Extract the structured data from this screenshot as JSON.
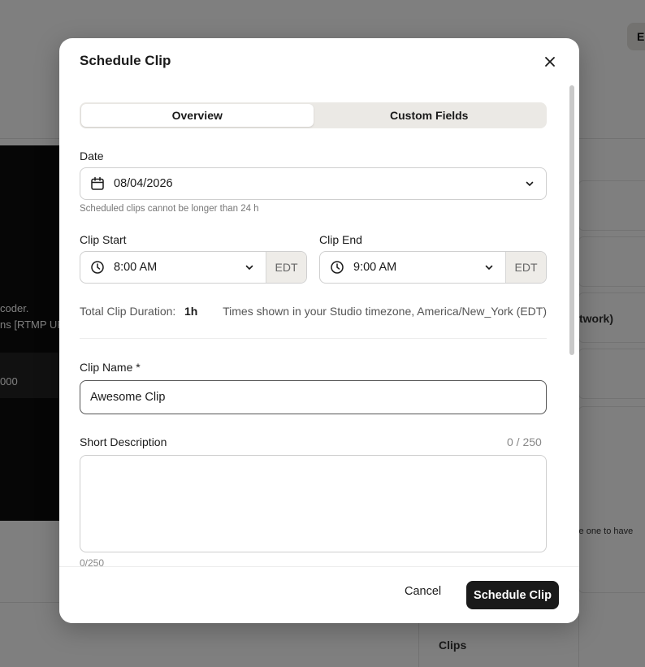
{
  "background": {
    "top_button_label": "En",
    "encoder_text": "coder.",
    "rtmp_text": "ns [RTMP UR",
    "row_value": "000",
    "network_text": "twork)",
    "note_text": "ale one to have",
    "clips_label": "Clips"
  },
  "modal": {
    "title": "Schedule Clip",
    "close_icon": "close-icon",
    "tabs": [
      {
        "label": "Overview",
        "active": true
      },
      {
        "label": "Custom Fields",
        "active": false
      }
    ],
    "date": {
      "label": "Date",
      "value": "08/04/2026",
      "icon": "calendar-icon",
      "hint": "Scheduled clips cannot be longer than 24 h"
    },
    "clip_start": {
      "label": "Clip Start",
      "value": "8:00 AM",
      "icon": "clock-icon",
      "timezone": "EDT"
    },
    "clip_end": {
      "label": "Clip End",
      "value": "9:00 AM",
      "icon": "clock-icon",
      "timezone": "EDT"
    },
    "duration": {
      "label": "Total Clip Duration:",
      "value": "1h",
      "timezone_note": "Times shown in your Studio timezone, America/New_York (EDT)"
    },
    "clip_name": {
      "label": "Clip Name *",
      "value": "Awesome Clip"
    },
    "short_description": {
      "label": "Short Description",
      "counter": "0 / 250",
      "value": "",
      "bottom_counter": "0/250"
    },
    "footer": {
      "cancel_label": "Cancel",
      "submit_label": "Schedule Clip"
    }
  }
}
